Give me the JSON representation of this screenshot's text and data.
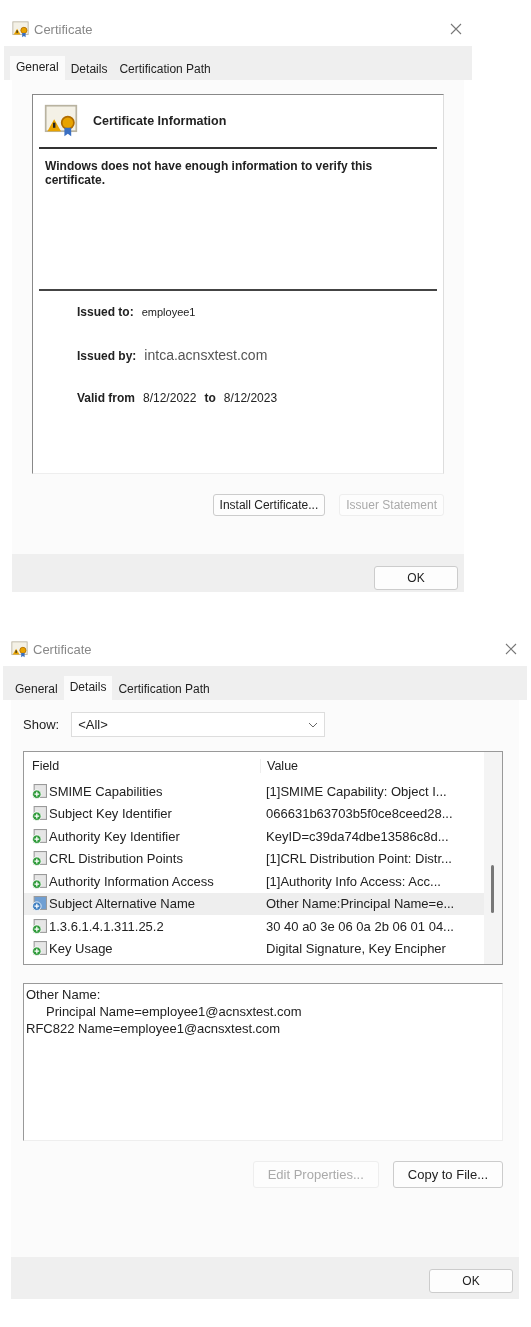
{
  "dialogs": [
    {
      "kind": "general",
      "title": "Certificate",
      "tabs": [
        {
          "label": "General",
          "selected": true
        },
        {
          "label": "Details",
          "selected": false
        },
        {
          "label": "Certification Path",
          "selected": false
        }
      ],
      "info_heading": "Certificate Information",
      "warning": "Windows does not have enough information to verify this certificate.",
      "issued_to_label": "Issued to:",
      "issued_to": "employee1",
      "issued_by_label": "Issued by:",
      "issued_by": "intca.acnsxtest.com",
      "valid_from_label": "Valid from",
      "valid_from": "8/12/2022",
      "valid_to_label": "to",
      "valid_to": "8/12/2023",
      "buttons": [
        {
          "label": "Install Certificate...",
          "disabled": false
        },
        {
          "label": "Issuer Statement",
          "disabled": true
        }
      ],
      "ok": "OK"
    },
    {
      "kind": "details",
      "title": "Certificate",
      "tabs": [
        {
          "label": "General",
          "selected": false
        },
        {
          "label": "Details",
          "selected": true
        },
        {
          "label": "Certification Path",
          "selected": false
        }
      ],
      "show_label": "Show:",
      "show_value": "<All>",
      "columns": [
        "Field",
        "Value"
      ],
      "rows": [
        {
          "field": "SMIME Capabilities",
          "value": "[1]SMIME Capability: Object I...",
          "selected": false
        },
        {
          "field": "Subject Key Identifier",
          "value": "066631b63703b5f0ce8ceed28...",
          "selected": false
        },
        {
          "field": "Authority Key Identifier",
          "value": "KeyID=c39da74dbe13586c8d...",
          "selected": false
        },
        {
          "field": "CRL Distribution Points",
          "value": "[1]CRL Distribution Point: Distr...",
          "selected": false
        },
        {
          "field": "Authority Information Access",
          "value": "[1]Authority Info Access: Acc...",
          "selected": false
        },
        {
          "field": "Subject Alternative Name",
          "value": "Other Name:Principal Name=e...",
          "selected": true
        },
        {
          "field": "1.3.6.1.4.1.311.25.2",
          "value": "30 40 a0 3e 06 0a 2b 06 01 04...",
          "selected": false
        },
        {
          "field": "Key Usage",
          "value": "Digital Signature, Key Encipher",
          "selected": false
        }
      ],
      "detail_lines": [
        {
          "text": "Other Name:",
          "children": [
            {
              "text": "Principal Name=employee1@acnsxtest.com"
            }
          ]
        },
        {
          "text": "RFC822 Name=employee1@acnsxtest.com"
        }
      ],
      "buttons": [
        {
          "label": "Edit Properties...",
          "disabled": true
        },
        {
          "label": "Copy to File...",
          "disabled": false
        }
      ],
      "ok": "OK"
    }
  ]
}
